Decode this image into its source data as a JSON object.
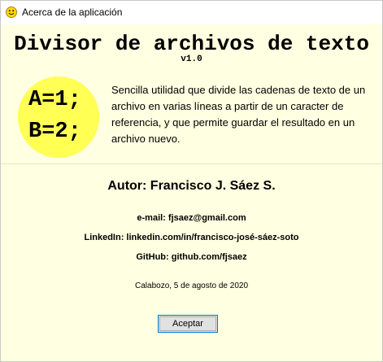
{
  "window": {
    "title": "Acerca de la aplicación",
    "icon": "smiley-icon"
  },
  "header": {
    "app_title": "Divisor de archivos de texto",
    "version": "v1.0",
    "logo": {
      "line1": "A=1;",
      "line2": "B=2;",
      "color": "#ffff54"
    },
    "description": "Sencilla utilidad que divide las cadenas de texto de un archivo en varias líneas a partir de un caracter de referencia, y que permite guardar el resultado en un archivo nuevo."
  },
  "author": {
    "name": "Autor: Francisco J. Sáez S.",
    "email": "e-mail: fjsaez@gmail.com",
    "linkedin": "LinkedIn: linkedin.com/in/francisco-josé-sáez-soto",
    "github": "GitHub: github.com/fjsaez"
  },
  "place_date": "Calabozo, 5 de agosto de 2020",
  "buttons": {
    "accept": "Aceptar"
  },
  "colors": {
    "background": "#ffffe1",
    "logo_circle": "#ffff54",
    "button_focus": "#0078d7"
  }
}
